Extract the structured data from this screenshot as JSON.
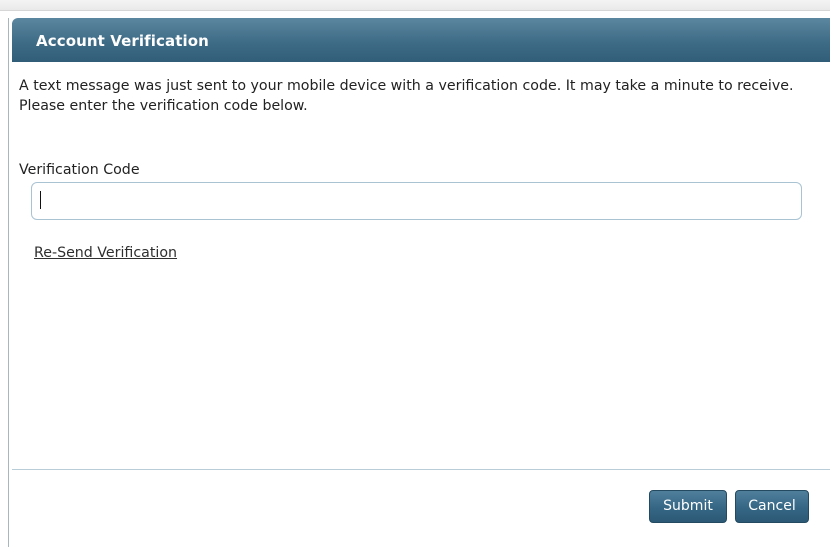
{
  "dialog": {
    "title": "Account Verification",
    "message": "A text message was just sent to your mobile device with a verification code. It may take a minute to receive. Please enter the verification code below.",
    "code_label": "Verification Code",
    "code_value": "",
    "resend_label": "Re-Send Verification"
  },
  "footer": {
    "submit_label": "Submit",
    "cancel_label": "Cancel"
  },
  "colors": {
    "header_gradient_top": "#5c87a0",
    "header_gradient_bottom": "#315d78",
    "button_fill": "#356684",
    "input_border": "#aac3d3"
  }
}
